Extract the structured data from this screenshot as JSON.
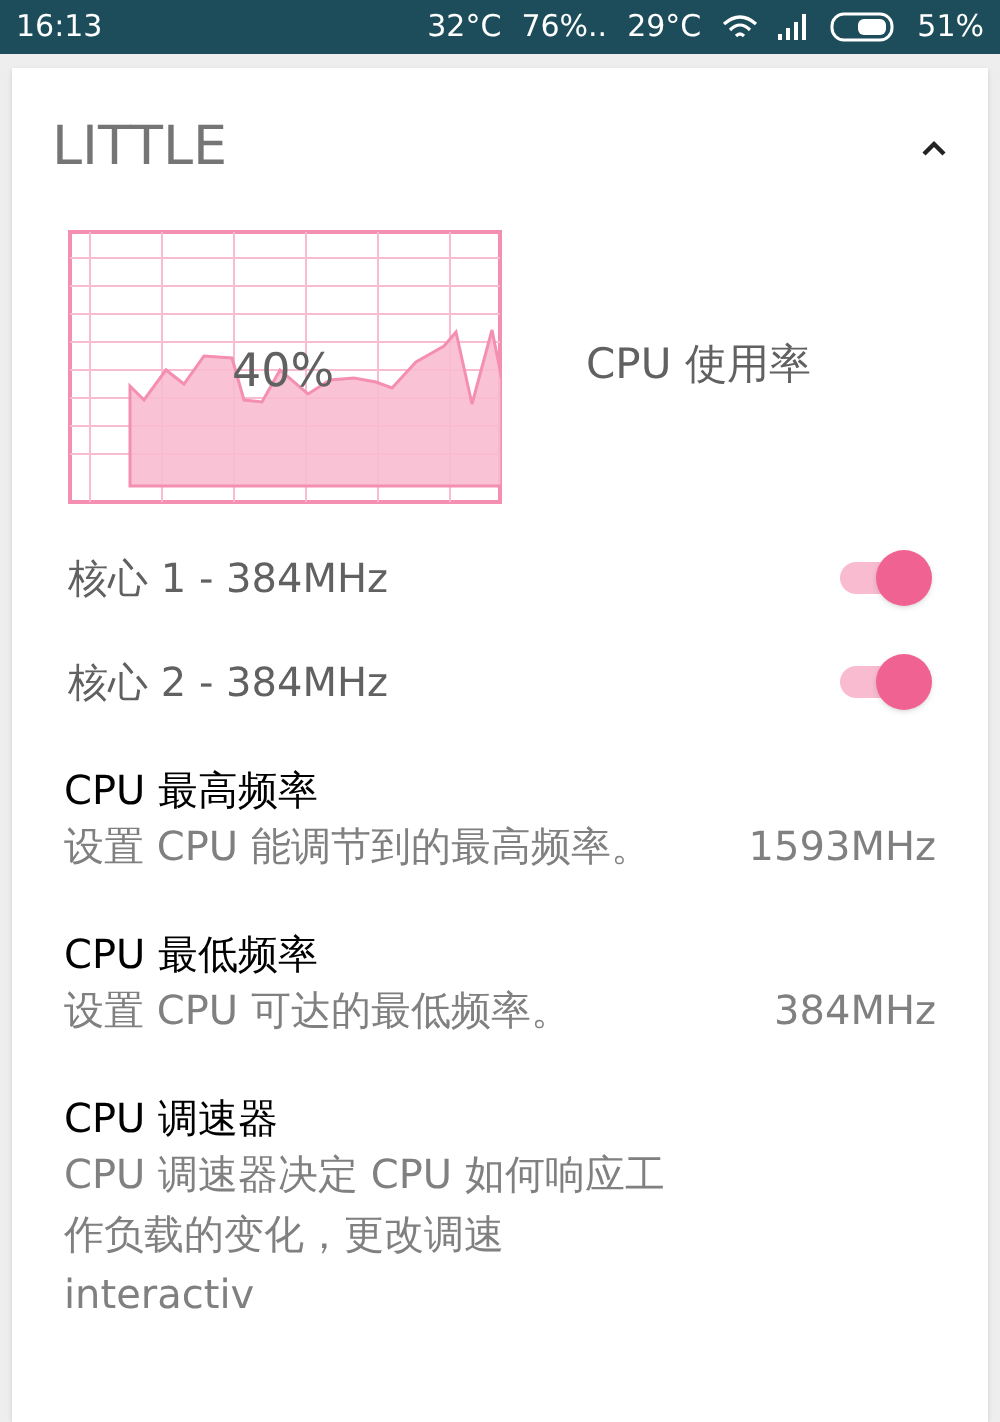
{
  "status_bar": {
    "time": "16:13",
    "cpu_temp": "32°C",
    "ram": "76%..",
    "battery_temp": "29°C",
    "battery": "51%"
  },
  "section": {
    "title": "LITTLE",
    "expanded": true
  },
  "usage": {
    "reading": "40%",
    "label": "CPU 使用率"
  },
  "cores": [
    {
      "label": "核心 1 - 384MHz",
      "on": true
    },
    {
      "label": "核心 2 - 384MHz",
      "on": true
    }
  ],
  "settings": [
    {
      "title": "CPU 最高频率",
      "description": "设置 CPU 能调节到的最高频率。",
      "value": "1593MHz"
    },
    {
      "title": "CPU 最低频率",
      "description": "设置 CPU 可达的最低频率。",
      "value": "384MHz"
    },
    {
      "title": "CPU 调速器",
      "description": "CPU 调速器决定 CPU 如何响应工作负载的变化，更改调速 interactiv"
    }
  ]
}
